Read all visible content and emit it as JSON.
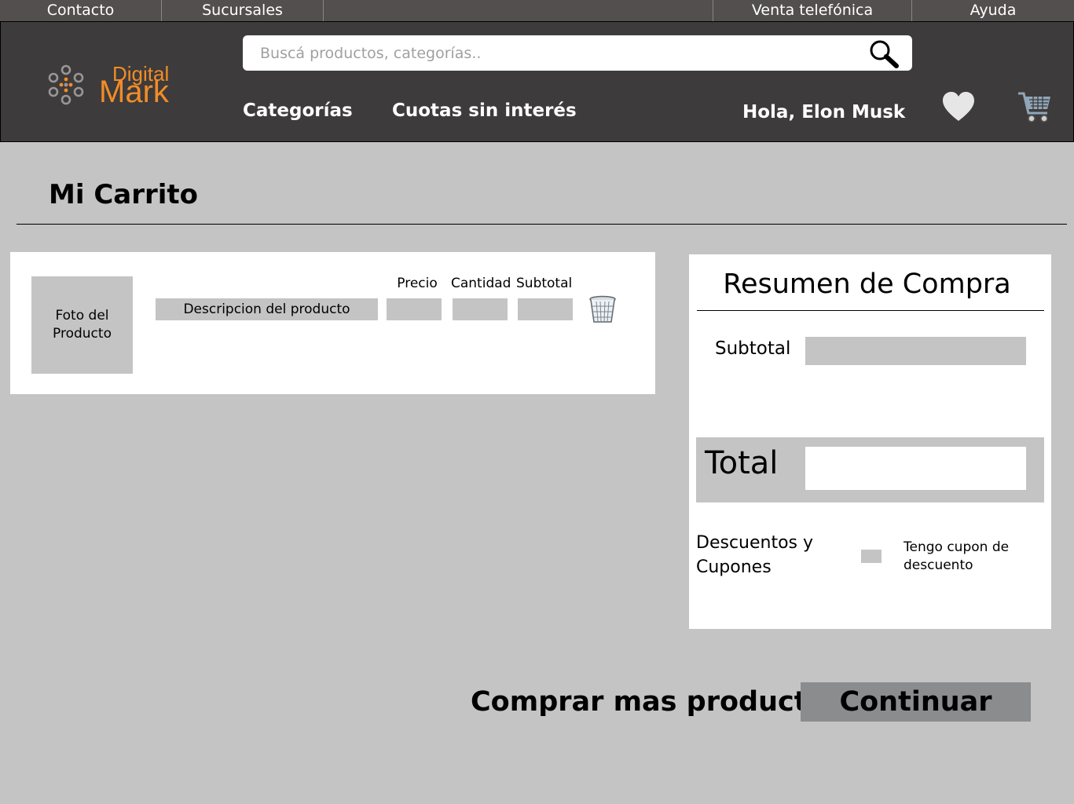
{
  "topbar": {
    "items": [
      "Contacto",
      "Sucursales",
      "Venta telefónica",
      "Ayuda"
    ]
  },
  "brand": {
    "line1": "Digital",
    "line2": "Mark",
    "accent_color": "#f28c28"
  },
  "header": {
    "search_placeholder": "Buscá productos, categorías..",
    "nav_categories": "Categorías",
    "nav_installments": "Cuotas sin interés",
    "greeting": "Hola, Elon Musk",
    "icons": [
      "search-icon",
      "heart-icon",
      "cart-icon"
    ]
  },
  "page": {
    "title": "Mi Carrito"
  },
  "cart": {
    "photo_label": "Foto del Producto",
    "description": "Descripcion del producto",
    "columns": {
      "price": "Precio",
      "quantity": "Cantidad",
      "subtotal": "Subtotal"
    },
    "delete_icon": "trash-icon"
  },
  "summary": {
    "title": "Resumen de Compra",
    "subtotal_label": "Subtotal",
    "total_label": "Total",
    "discounts_label": "Descuentos y Cupones",
    "coupon_label": "Tengo cupon de descuento"
  },
  "actions": {
    "more_products": "Comprar mas productos",
    "continue": "Continuar"
  }
}
